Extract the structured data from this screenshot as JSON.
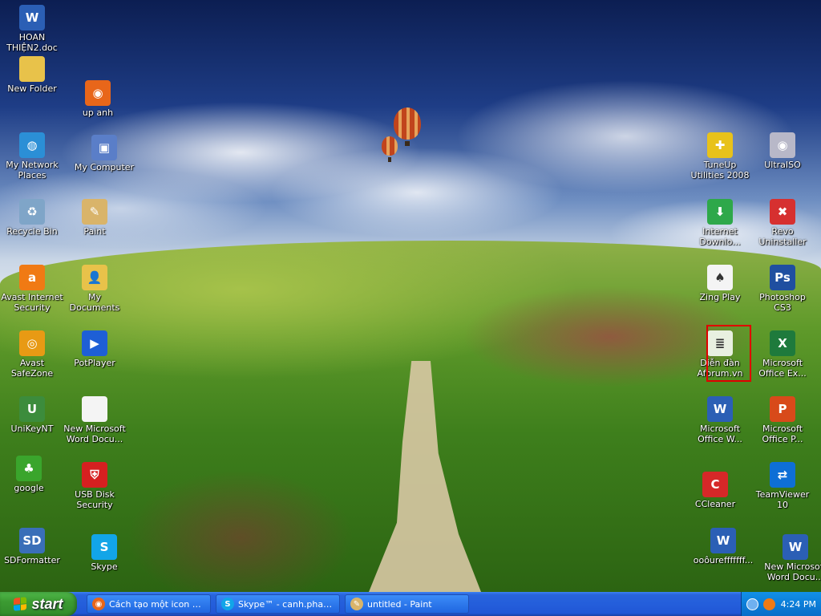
{
  "desktop": {
    "left_icons": [
      {
        "id": "hoan-thien-doc",
        "label": "HOAN\nTHIỆN2.doc",
        "icon": "word-document-icon",
        "color": "#2b5fb5",
        "glyph": "W"
      },
      {
        "id": "new-folder",
        "label": "New Folder",
        "icon": "folder-icon",
        "color": "#e8c24a",
        "glyph": ""
      },
      {
        "id": "up-anh",
        "label": "up anh",
        "icon": "firefox-shortcut-icon",
        "color": "#e8661a",
        "glyph": "◉"
      },
      {
        "id": "my-network-places",
        "label": "My Network\nPlaces",
        "icon": "network-globe-icon",
        "color": "#2b8fd6",
        "glyph": "◍"
      },
      {
        "id": "my-computer",
        "label": "My Computer",
        "icon": "computer-icon",
        "color": "#5a7ec8",
        "glyph": "▣"
      },
      {
        "id": "recycle-bin",
        "label": "Recycle Bin",
        "icon": "recycle-bin-icon",
        "color": "#7fa5c8",
        "glyph": "♻"
      },
      {
        "id": "paint",
        "label": "Paint",
        "icon": "paint-palette-icon",
        "color": "#d9b46a",
        "glyph": "✎"
      },
      {
        "id": "avast-internet-security",
        "label": "Avast Internet\nSecurity",
        "icon": "avast-icon",
        "color": "#f07a14",
        "glyph": "a"
      },
      {
        "id": "my-documents",
        "label": "My Documents",
        "icon": "documents-folder-icon",
        "color": "#e8c24a",
        "glyph": "👤"
      },
      {
        "id": "avast-safezone",
        "label": "Avast\nSafeZone",
        "icon": "safezone-globe-icon",
        "color": "#e89a14",
        "glyph": "◎"
      },
      {
        "id": "potplayer",
        "label": "PotPlayer",
        "icon": "potplayer-icon",
        "color": "#1e5fd6",
        "glyph": "▶"
      },
      {
        "id": "unikeynt",
        "label": "UniKeyNT",
        "icon": "unikey-icon",
        "color": "#3c8c3c",
        "glyph": "U"
      },
      {
        "id": "new-word-doc",
        "label": "New Microsoft\nWord Docu...",
        "icon": "blank-document-icon",
        "color": "#f4f4f4",
        "glyph": ""
      },
      {
        "id": "google",
        "label": "google",
        "icon": "tree-icon",
        "color": "#3aa52c",
        "glyph": "♣"
      },
      {
        "id": "usb-disk-security",
        "label": "USB Disk\nSecurity",
        "icon": "shield-icon",
        "color": "#d62020",
        "glyph": "⛨"
      },
      {
        "id": "sdformatter",
        "label": "SDFormatter",
        "icon": "sd-card-icon",
        "color": "#3a6fb8",
        "glyph": "SD"
      },
      {
        "id": "skype",
        "label": "Skype",
        "icon": "skype-icon",
        "color": "#12a5e8",
        "glyph": "S"
      }
    ],
    "right_icons": [
      {
        "id": "tuneup",
        "label": "TuneUp\nUtilities 2008",
        "icon": "tuneup-icon",
        "color": "#e8c21a",
        "glyph": "✚"
      },
      {
        "id": "ultraiso",
        "label": "UltraISO",
        "icon": "disc-icon",
        "color": "#b8b8c8",
        "glyph": "◉"
      },
      {
        "id": "internet-download",
        "label": "Internet\nDownlo...",
        "icon": "idm-icon",
        "color": "#2ea84a",
        "glyph": "⬇"
      },
      {
        "id": "revo-uninstaller",
        "label": "Revo\nUninstaller",
        "icon": "revo-icon",
        "color": "#d63030",
        "glyph": "✖"
      },
      {
        "id": "zing-play",
        "label": "Zing Play",
        "icon": "playing-cards-icon",
        "color": "#f4f4f4",
        "glyph": "♠"
      },
      {
        "id": "photoshop-cs3",
        "label": "Photoshop\nCS3",
        "icon": "photoshop-icon",
        "color": "#1f4fa0",
        "glyph": "Ps"
      },
      {
        "id": "dien-dan-aforum",
        "label": "Diễn đàn\nAforum.vn",
        "icon": "forum-shortcut-icon",
        "color": "#e8f0e0",
        "glyph": "≣"
      },
      {
        "id": "ms-office-excel",
        "label": "Microsoft\nOffice Ex...",
        "icon": "excel-icon",
        "color": "#1e7a3c",
        "glyph": "X"
      },
      {
        "id": "ms-office-word",
        "label": "Microsoft\nOffice W...",
        "icon": "word-icon",
        "color": "#2b5fb5",
        "glyph": "W"
      },
      {
        "id": "ms-office-powerpoint",
        "label": "Microsoft\nOffice P...",
        "icon": "powerpoint-icon",
        "color": "#d84a1a",
        "glyph": "P"
      },
      {
        "id": "ccleaner",
        "label": "CCleaner",
        "icon": "ccleaner-icon",
        "color": "#d62828",
        "glyph": "C"
      },
      {
        "id": "teamviewer",
        "label": "TeamViewer\n10",
        "icon": "teamviewer-icon",
        "color": "#0e6fd6",
        "glyph": "⇄"
      },
      {
        "id": "oooffffff",
        "label": "ooôurefffffff...",
        "icon": "word-document-icon",
        "color": "#2b5fb5",
        "glyph": "W"
      },
      {
        "id": "new-ms-word-doc-2",
        "label": "New Microsoft\nWord Docu...",
        "icon": "word-document-icon",
        "color": "#2b5fb5",
        "glyph": "W"
      }
    ]
  },
  "taskbar": {
    "start_label": "start",
    "tasks": [
      {
        "label": "Cách tạo một icon ch...",
        "icon": "firefox-icon",
        "color": "#e8661a",
        "glyph": "◉"
      },
      {
        "label": "Skype™ - canh.pham...",
        "icon": "skype-icon",
        "color": "#12a5e8",
        "glyph": "S"
      },
      {
        "label": "untitled - Paint",
        "icon": "paint-icon",
        "color": "#d9b46a",
        "glyph": "✎"
      }
    ],
    "tray": {
      "clock": "4:24 PM",
      "icons": [
        {
          "icon": "tray-expand-icon",
          "color": "#6fb0f0"
        },
        {
          "icon": "avast-tray-icon",
          "color": "#f07a14"
        }
      ]
    }
  }
}
